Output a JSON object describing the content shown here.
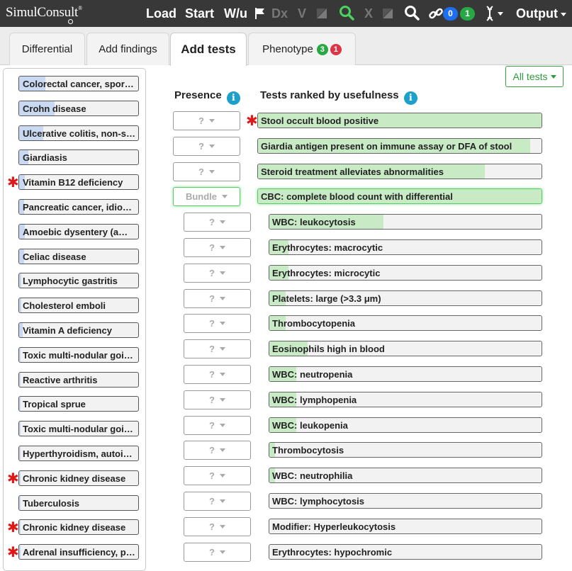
{
  "app": {
    "logo": "SimulConsult",
    "menu": {
      "load": "Load",
      "start": "Start",
      "wu": "W/u",
      "dx": "Dx",
      "v": "V",
      "x": "X",
      "output": "Output"
    },
    "badges": {
      "blue": "0",
      "green": "1"
    },
    "colors": {
      "topbar": "#383838",
      "blue_badge": "#1e6ff0",
      "green_badge": "#28a745",
      "red_badge": "#dc3545"
    }
  },
  "tabs": [
    {
      "label": "Differential"
    },
    {
      "label": "Add findings"
    },
    {
      "label": "Add tests"
    },
    {
      "label": "Phenotype",
      "green": "3",
      "red": "1"
    }
  ],
  "filter": {
    "label": "All tests"
  },
  "headers": {
    "presence": "Presence",
    "tests": "Tests ranked by usefulness"
  },
  "differential": [
    {
      "label": "Colorectal cancer, sporadic",
      "fill": 0.22,
      "star": false
    },
    {
      "label": "Crohn disease",
      "fill": 0.3,
      "star": false
    },
    {
      "label": "Ulcerative colitis, non-specific",
      "fill": 0.2,
      "star": false
    },
    {
      "label": "Giardiasis",
      "fill": 0.08,
      "star": false
    },
    {
      "label": "Vitamin B12 deficiency",
      "fill": 0.05,
      "star": true
    },
    {
      "label": "Pancreatic cancer, idiopathic",
      "fill": 0.04,
      "star": false
    },
    {
      "label": "Amoebic dysentery (amebiasis)",
      "fill": 0.05,
      "star": false
    },
    {
      "label": "Celiac disease",
      "fill": 0.04,
      "star": false
    },
    {
      "label": "Lymphocytic gastritis",
      "fill": 0.02,
      "star": false
    },
    {
      "label": "Cholesterol emboli",
      "fill": 0.02,
      "star": false
    },
    {
      "label": "Vitamin A deficiency",
      "fill": 0.03,
      "star": false
    },
    {
      "label": "Toxic multi-nodular goiter",
      "fill": 0.01,
      "star": false
    },
    {
      "label": "Reactive arthritis",
      "fill": 0.01,
      "star": false
    },
    {
      "label": "Tropical sprue",
      "fill": 0.01,
      "star": false
    },
    {
      "label": "Toxic multi-nodular goiter",
      "fill": 0.01,
      "star": false
    },
    {
      "label": "Hyperthyroidism, autoimmune",
      "fill": 0.01,
      "star": false
    },
    {
      "label": "Chronic kidney disease",
      "fill": 0.01,
      "star": true
    },
    {
      "label": "Tuberculosis",
      "fill": 0.01,
      "star": false
    },
    {
      "label": "Chronic kidney disease",
      "fill": 0.01,
      "star": true
    },
    {
      "label": "Adrenal insufficiency, primary",
      "fill": 0.01,
      "star": true
    }
  ],
  "tests": [
    {
      "presence": "?",
      "label": "Stool occult blood positive",
      "fill": 1.0,
      "star": true,
      "indent": false
    },
    {
      "presence": "?",
      "label": "Giardia antigen present on immune assay or DFA of stool",
      "fill": 0.96,
      "star": false,
      "indent": false
    },
    {
      "presence": "?",
      "label": "Steroid treatment alleviates abnormalities",
      "fill": 0.8,
      "star": false,
      "indent": false
    },
    {
      "presence": "Bundle",
      "label": "CBC: complete blood count with differential",
      "fill": 1.0,
      "star": false,
      "indent": false,
      "bundle": true
    },
    {
      "presence": "?",
      "label": "WBC: leukocytosis",
      "fill": 0.42,
      "star": false,
      "indent": true
    },
    {
      "presence": "?",
      "label": "Erythrocytes: macrocytic",
      "fill": 0.07,
      "star": false,
      "indent": true
    },
    {
      "presence": "?",
      "label": "Erythrocytes: microcytic",
      "fill": 0.07,
      "star": false,
      "indent": true
    },
    {
      "presence": "?",
      "label": "Platelets: large (>3.3 μm)",
      "fill": 0.06,
      "star": false,
      "indent": true
    },
    {
      "presence": "?",
      "label": "Thrombocytopenia",
      "fill": 0.06,
      "star": false,
      "indent": true
    },
    {
      "presence": "?",
      "label": "Eosinophils high in blood",
      "fill": 0.14,
      "star": false,
      "indent": true
    },
    {
      "presence": "?",
      "label": "WBC: neutropenia",
      "fill": 0.1,
      "star": false,
      "indent": true
    },
    {
      "presence": "?",
      "label": "WBC: lymphopenia",
      "fill": 0.1,
      "star": false,
      "indent": true
    },
    {
      "presence": "?",
      "label": "WBC: leukopenia",
      "fill": 0.1,
      "star": false,
      "indent": true
    },
    {
      "presence": "?",
      "label": "Thrombocytosis",
      "fill": 0.02,
      "star": false,
      "indent": true
    },
    {
      "presence": "?",
      "label": "WBC: neutrophilia",
      "fill": 0.02,
      "star": false,
      "indent": true
    },
    {
      "presence": "?",
      "label": "WBC: lymphocytosis",
      "fill": 0.0,
      "star": false,
      "indent": true
    },
    {
      "presence": "?",
      "label": "Modifier: Hyperleukocytosis",
      "fill": 0.0,
      "star": false,
      "indent": true
    },
    {
      "presence": "?",
      "label": "Erythrocytes: hypochromic",
      "fill": 0.0,
      "star": false,
      "indent": true
    }
  ]
}
